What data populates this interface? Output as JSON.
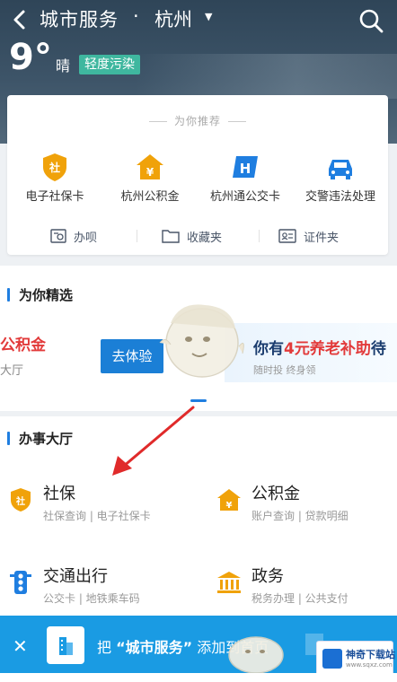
{
  "header": {
    "title": "城市服务",
    "separator": "·",
    "city": "杭州",
    "city_caret": "▼"
  },
  "weather": {
    "temperature": "9°",
    "condition": "晴",
    "air_quality": "轻度污染"
  },
  "recommend": {
    "title": "为你推荐",
    "services": [
      {
        "label": "电子社保卡",
        "icon": "social-security-shield-icon",
        "color": "#f0a20a"
      },
      {
        "label": "杭州公积金",
        "icon": "housing-fund-house-icon",
        "color": "#f0a20a"
      },
      {
        "label": "杭州通公交卡",
        "icon": "bus-card-h-icon",
        "color": "#1f7ee0"
      },
      {
        "label": "交警违法处理",
        "icon": "traffic-car-icon",
        "color": "#1f7ee0"
      }
    ],
    "tools": [
      {
        "label": "办呗",
        "icon": "banbei-icon"
      },
      {
        "label": "收藏夹",
        "icon": "folder-icon"
      },
      {
        "label": "证件夹",
        "icon": "id-card-icon"
      }
    ]
  },
  "featured": {
    "title": "为你精选",
    "left_card": {
      "title": "公积金",
      "sub": "大厅"
    },
    "try_button": "去体验",
    "right_card": {
      "title_prefix": "你有",
      "title_amount": "4元养老补助",
      "title_suffix": "待",
      "sub": "随时投  终身领"
    }
  },
  "hall": {
    "title": "办事大厅",
    "items": [
      {
        "title": "社保",
        "sub": "社保查询 | 电子社保卡",
        "icon": "social-security-icon",
        "color": "#f0a20a"
      },
      {
        "title": "公积金",
        "sub": "账户查询 | 贷款明细",
        "icon": "housing-fund-icon",
        "color": "#f0a20a"
      },
      {
        "title": "交通出行",
        "sub": "公交卡 | 地铁乘车码",
        "icon": "traffic-light-icon",
        "color": "#1f7ee0"
      },
      {
        "title": "政务",
        "sub": "税务办理 | 公共支付",
        "icon": "government-building-icon",
        "color": "#f0a20a"
      }
    ]
  },
  "banner": {
    "close": "✕",
    "prefix": "把",
    "app_name": "“城市服务”",
    "suffix": "添加到首页"
  },
  "watermark": {
    "name": "神奇下载站",
    "url": "www.sqxz.com"
  },
  "colors": {
    "accent": "#1f7ee0",
    "aqi_badge": "#3fb79f",
    "banner": "#1a9be3",
    "promo_red": "#e23a3a"
  }
}
